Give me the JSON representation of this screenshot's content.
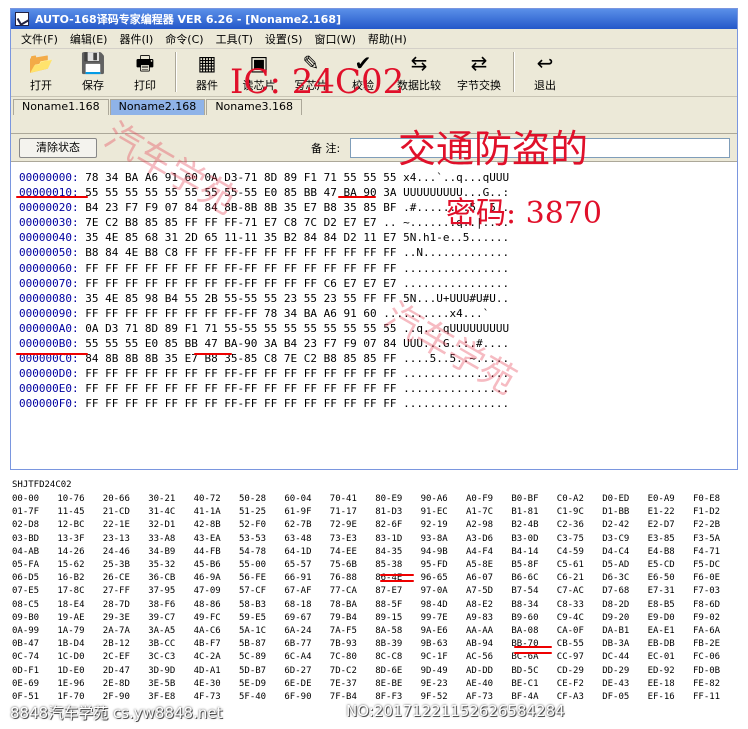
{
  "window": {
    "title": "AUTO-168译码专家编程器 VER 6.26 - [Noname2.168]"
  },
  "menu": [
    "文件(F)",
    "编辑(E)",
    "器件(I)",
    "命令(C)",
    "工具(T)",
    "设置(S)",
    "窗口(W)",
    "帮助(H)"
  ],
  "toolbar": [
    {
      "label": "打开",
      "icon": "folder-open-icon",
      "glyph": "📂"
    },
    {
      "label": "保存",
      "icon": "floppy-icon",
      "glyph": "💾"
    },
    {
      "label": "打印",
      "icon": "printer-icon",
      "glyph": "🖶"
    },
    {
      "label": "器件",
      "icon": "chip-icon",
      "glyph": "▦"
    },
    {
      "label": "读芯片",
      "icon": "read-chip-icon",
      "glyph": "▣"
    },
    {
      "label": "写芯片",
      "icon": "write-chip-icon",
      "glyph": "✎"
    },
    {
      "label": "校验",
      "icon": "verify-icon",
      "glyph": "✔"
    },
    {
      "label": "数据比较",
      "icon": "compare-icon",
      "glyph": "⇆"
    },
    {
      "label": "字节交换",
      "icon": "swap-icon",
      "glyph": "⇄"
    },
    {
      "label": "退出",
      "icon": "exit-icon",
      "glyph": "↩"
    }
  ],
  "tabs": [
    "Noname1.168",
    "Noname2.168",
    "Noname3.168"
  ],
  "active_tab": 1,
  "status": {
    "clear_label": "清除状态",
    "note_label": "备 注:"
  },
  "hex_rows": [
    {
      "addr": "00000000:",
      "data": "78 34 BA A6 91 60 0A D3-71 8D 89 F1 71 55 55 55",
      "ascii": "x4...`..q...qUUU"
    },
    {
      "addr": "00000010:",
      "data": "55 55 55 55 55 55 55 55-55 E0 85 BB 47 BA 90 3A",
      "ascii": "UUUUUUUUU...G..:"
    },
    {
      "addr": "00000020:",
      "data": "B4 23 F7 F9 07 84 84 8B-8B 8B 35 E7 B8 35 85 BF",
      "ascii": ".#........5..5.."
    },
    {
      "addr": "00000030:",
      "data": "7E C2 B8 85 85 FF FF FF-71 E7 C8 7C D2 E7 E7 ..",
      "ascii": "~.......q..|...."
    },
    {
      "addr": "00000040:",
      "data": "35 4E 85 68 31 2D 65 11-11 35 B2 84 84 D2 11 E7",
      "ascii": "5N.h1-e..5......"
    },
    {
      "addr": "00000050:",
      "data": "B8 84 4E B8 C8 FF FF FF-FF FF FF FF FF FF FF FF",
      "ascii": "..N............."
    },
    {
      "addr": "00000060:",
      "data": "FF FF FF FF FF FF FF FF-FF FF FF FF FF FF FF FF",
      "ascii": "................"
    },
    {
      "addr": "00000070:",
      "data": "FF FF FF FF FF FF FF FF-FF FF FF FF C6 E7 E7 E7",
      "ascii": "................"
    },
    {
      "addr": "00000080:",
      "data": "35 4E 85 98 B4 55 2B 55-55 55 23 55 23 55 FF FF",
      "ascii": "5N...U+UUU#U#U.."
    },
    {
      "addr": "00000090:",
      "data": "FF FF FF FF FF FF FF FF-FF 78 34 BA A6 91 60",
      "ascii": "..........x4...`"
    },
    {
      "addr": "000000A0:",
      "data": "0A D3 71 8D 89 F1 71 55-55 55 55 55 55 55 55 55",
      "ascii": "..q...qUUUUUUUUU"
    },
    {
      "addr": "000000B0:",
      "data": "55 55 55 E0 85 BB 47 BA-90 3A B4 23 F7 F9 07 84",
      "ascii": "UUU...G..:.#...."
    },
    {
      "addr": "000000C0:",
      "data": "84 8B 8B 8B 35 E7 B8 35-85 C8 7E C2 B8 85 85 FF",
      "ascii": "....5..5..~....."
    },
    {
      "addr": "000000D0:",
      "data": "FF FF FF FF FF FF FF FF-FF FF FF FF FF FF FF FF",
      "ascii": "................"
    },
    {
      "addr": "000000E0:",
      "data": "FF FF FF FF FF FF FF FF-FF FF FF FF FF FF FF FF",
      "ascii": "................"
    },
    {
      "addr": "000000F0:",
      "data": "FF FF FF FF FF FF FF FF-FF FF FF FF FF FF FF FF",
      "ascii": "................"
    }
  ],
  "annotations": {
    "ic": "IC: 24C02",
    "purpose": "交通防盗的",
    "pin": "密码: 3870"
  },
  "watermark": "汽车学苑",
  "chart_title": "SHJTFD24C02",
  "chart_rows": [
    [
      "00-00",
      "10-76",
      "20-66",
      "30-21",
      "40-72",
      "50-28",
      "60-04",
      "70-41",
      "80-E9",
      "90-A6",
      "A0-F9",
      "B0-BF",
      "C0-A2",
      "D0-ED",
      "E0-A9",
      "F0-E8"
    ],
    [
      "01-7F",
      "11-45",
      "21-CD",
      "31-4C",
      "41-1A",
      "51-25",
      "61-9F",
      "71-17",
      "81-D3",
      "91-EC",
      "A1-7C",
      "B1-81",
      "C1-9C",
      "D1-BB",
      "E1-22",
      "F1-D2"
    ],
    [
      "02-D8",
      "12-BC",
      "22-1E",
      "32-D1",
      "42-8B",
      "52-F0",
      "62-7B",
      "72-9E",
      "82-6F",
      "92-19",
      "A2-98",
      "B2-4B",
      "C2-36",
      "D2-42",
      "E2-D7",
      "F2-2B"
    ],
    [
      "03-BD",
      "13-3F",
      "23-13",
      "33-A8",
      "43-EA",
      "53-53",
      "63-48",
      "73-E3",
      "83-1D",
      "93-8A",
      "A3-D6",
      "B3-0D",
      "C3-75",
      "D3-C9",
      "E3-85",
      "F3-5A"
    ],
    [
      "04-AB",
      "14-26",
      "24-46",
      "34-B9",
      "44-FB",
      "54-78",
      "64-1D",
      "74-EE",
      "84-35",
      "94-9B",
      "A4-F4",
      "B4-14",
      "C4-59",
      "D4-C4",
      "E4-B8",
      "F4-71"
    ],
    [
      "05-FA",
      "15-62",
      "25-3B",
      "35-32",
      "45-B6",
      "55-00",
      "65-57",
      "75-6B",
      "85-38",
      "95-FD",
      "A5-8E",
      "B5-8F",
      "C5-61",
      "D5-AD",
      "E5-CD",
      "F5-DC"
    ],
    [
      "06-D5",
      "16-B2",
      "26-CE",
      "36-CB",
      "46-9A",
      "56-FE",
      "66-91",
      "76-88",
      "86-4E",
      "96-65",
      "A6-07",
      "B6-6C",
      "C6-21",
      "D6-3C",
      "E6-50",
      "F6-0E"
    ],
    [
      "07-E5",
      "17-8C",
      "27-FF",
      "37-95",
      "47-09",
      "57-CF",
      "67-AF",
      "77-CA",
      "87-E7",
      "97-0A",
      "A7-5D",
      "B7-54",
      "C7-AC",
      "D7-68",
      "E7-31",
      "F7-03"
    ],
    [
      "08-C5",
      "18-E4",
      "28-7D",
      "38-F6",
      "48-86",
      "58-B3",
      "68-18",
      "78-BA",
      "88-5F",
      "98-4D",
      "A8-E2",
      "B8-34",
      "C8-33",
      "D8-2D",
      "E8-B5",
      "F8-6D"
    ],
    [
      "09-B0",
      "19-AE",
      "29-3E",
      "39-C7",
      "49-FC",
      "59-E5",
      "69-67",
      "79-B4",
      "89-15",
      "99-7E",
      "A9-83",
      "B9-60",
      "C9-4C",
      "D9-20",
      "E9-D0",
      "F9-02"
    ],
    [
      "0A-99",
      "1A-79",
      "2A-7A",
      "3A-A5",
      "4A-C6",
      "5A-1C",
      "6A-24",
      "7A-F5",
      "8A-58",
      "9A-E6",
      "AA-AA",
      "BA-08",
      "CA-0F",
      "DA-B1",
      "EA-E1",
      "FA-6A"
    ],
    [
      "0B-47",
      "1B-D4",
      "2B-12",
      "3B-CC",
      "4B-F7",
      "5B-87",
      "6B-77",
      "7B-93",
      "8B-39",
      "9B-63",
      "AB-94",
      "BB-70",
      "CB-55",
      "DB-3A",
      "EB-DB",
      "FB-2E"
    ],
    [
      "0C-74",
      "1C-D0",
      "2C-EF",
      "3C-C3",
      "4C-2A",
      "5C-89",
      "6C-A4",
      "7C-80",
      "8C-C8",
      "9C-1F",
      "AC-56",
      "BC-6A",
      "CC-97",
      "DC-44",
      "EC-01",
      "FC-06"
    ],
    [
      "0D-F1",
      "1D-E0",
      "2D-47",
      "3D-9D",
      "4D-A1",
      "5D-B7",
      "6D-27",
      "7D-C2",
      "8D-6E",
      "9D-49",
      "AD-DD",
      "BD-5C",
      "CD-29",
      "DD-29",
      "ED-92",
      "FD-0B"
    ],
    [
      "0E-69",
      "1E-96",
      "2E-8D",
      "3E-5B",
      "4E-30",
      "5E-D9",
      "6E-DE",
      "7E-37",
      "8E-BE",
      "9E-23",
      "AE-40",
      "BE-C1",
      "CE-F2",
      "DE-43",
      "EE-18",
      "FE-82"
    ],
    [
      "0F-51",
      "1F-70",
      "2F-90",
      "3F-E8",
      "4F-73",
      "5F-40",
      "6F-90",
      "7F-B4",
      "8F-F3",
      "9F-52",
      "AF-73",
      "BF-4A",
      "CF-A3",
      "DF-05",
      "EF-16",
      "FF-11"
    ]
  ],
  "footer": {
    "left": "8848汽车学苑 cs.yw8848.net",
    "right": "NO:20171221152626584284"
  },
  "colors": {
    "annotation": "#e0102a",
    "titlebar": "#2458c9",
    "active_tab": "#8fb3e8"
  }
}
